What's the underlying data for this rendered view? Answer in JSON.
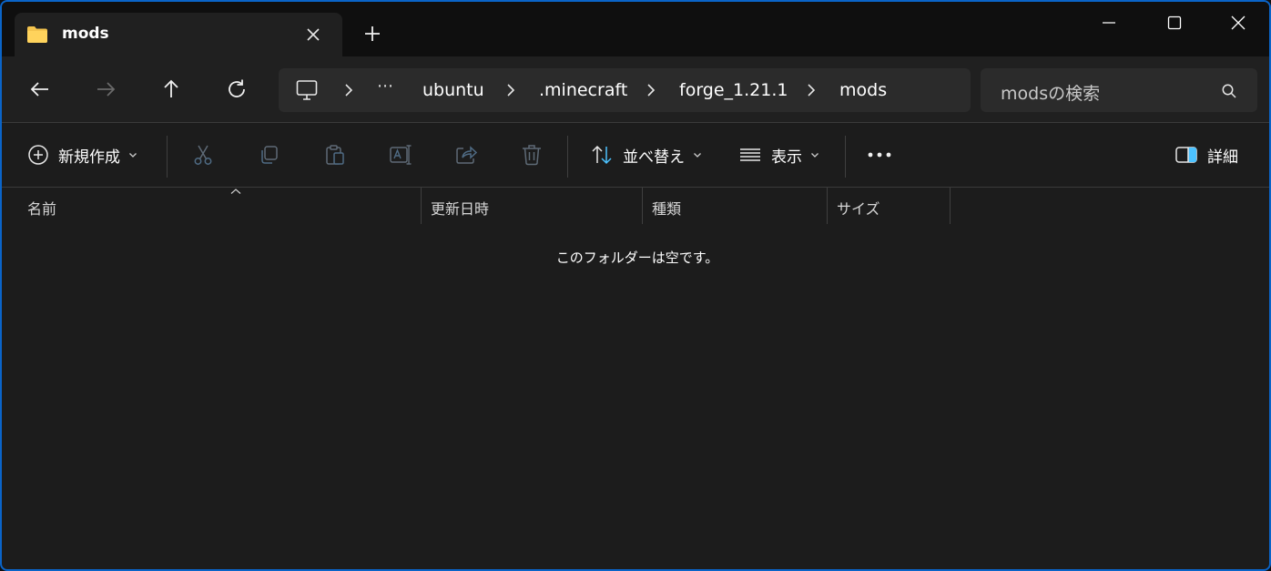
{
  "tab": {
    "title": "mods",
    "folder_color": "#f4c44e"
  },
  "address": {
    "overflow": "⋯",
    "crumbs": [
      "ubuntu",
      ".minecraft",
      "forge_1.21.1",
      "mods"
    ]
  },
  "search": {
    "placeholder": "modsの検索"
  },
  "commands": {
    "new": "新規作成",
    "sort": "並べ替え",
    "view": "表示",
    "more": "•••",
    "details": "詳細"
  },
  "columns": [
    "名前",
    "更新日時",
    "種類",
    "サイズ"
  ],
  "empty_message": "このフォルダーは空です。",
  "colors": {
    "accent": "#0a64c8",
    "icon_blue": "#4cc2ff",
    "disabled": "#5e6a76"
  }
}
